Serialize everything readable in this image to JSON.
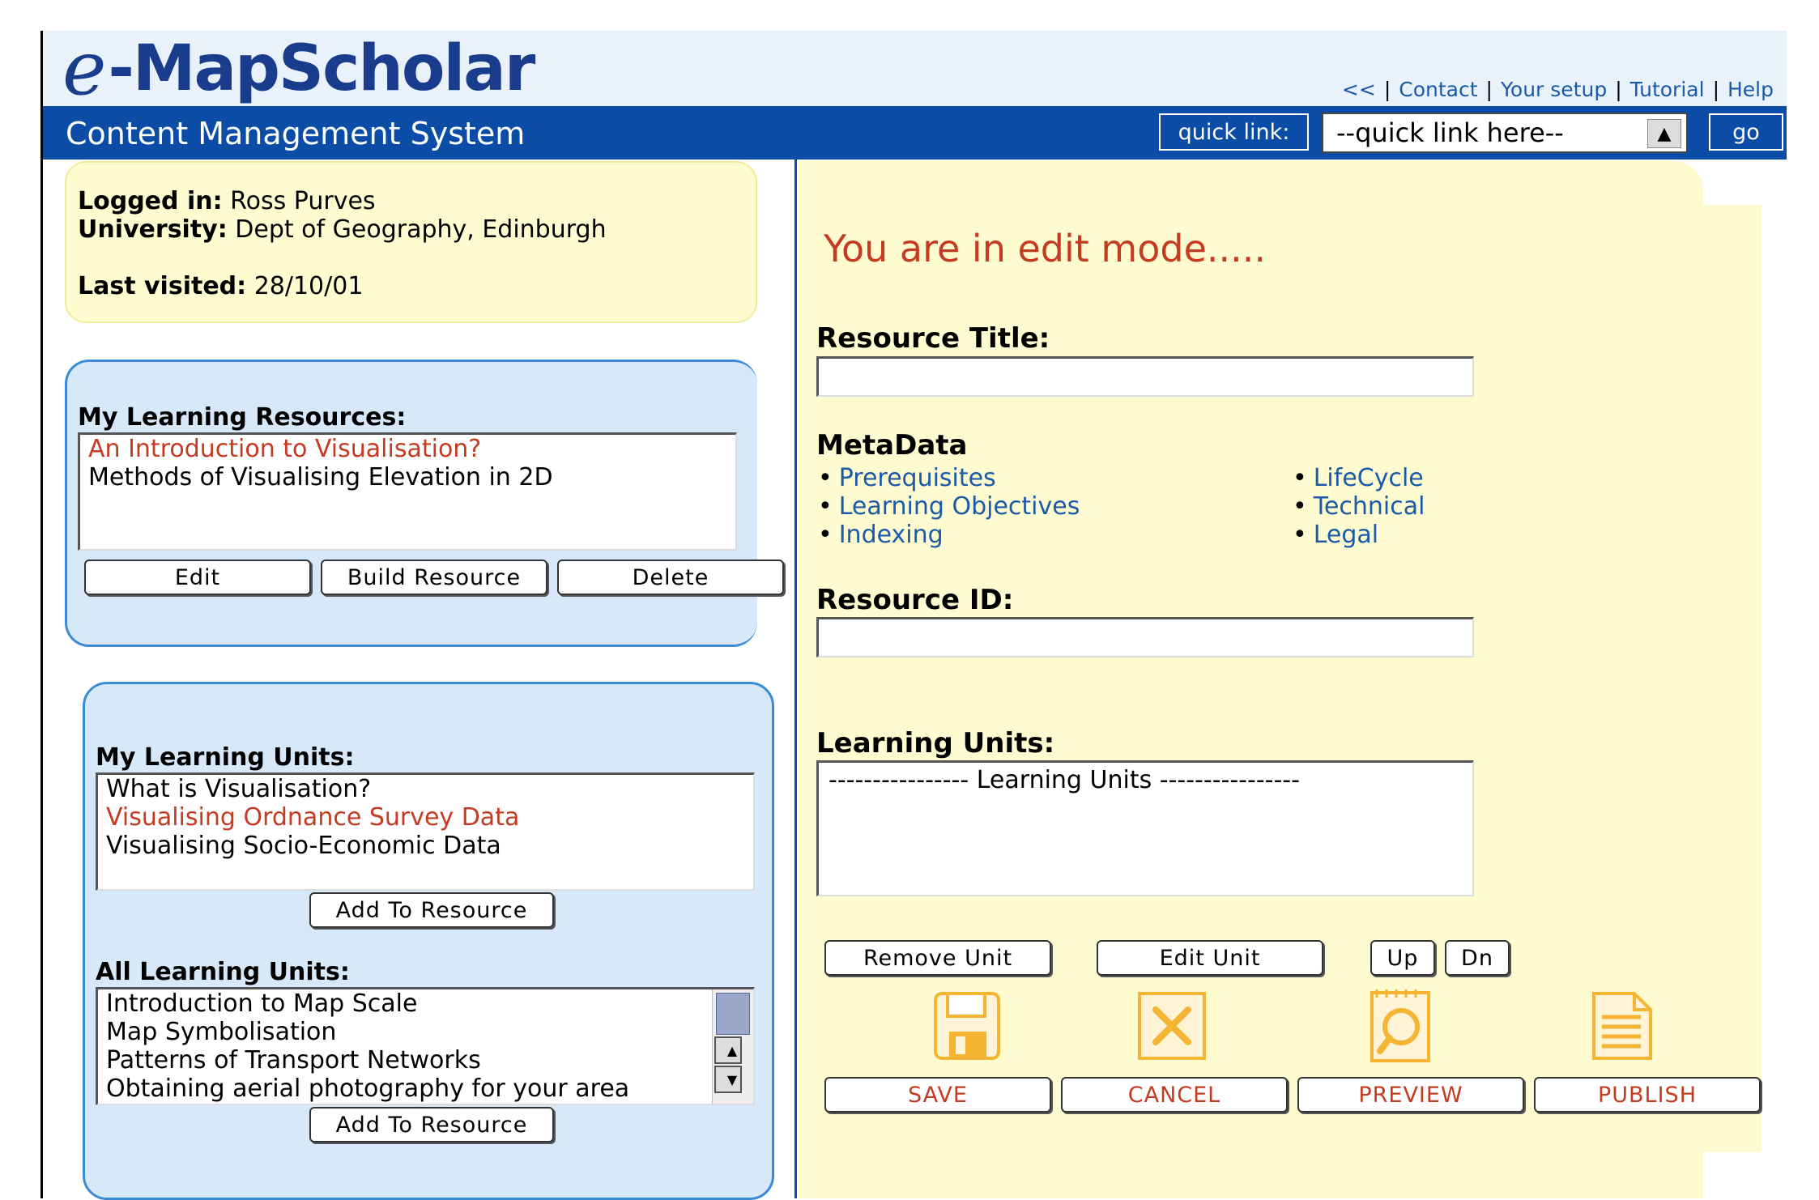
{
  "header": {
    "logo_e": "e",
    "logo_rest": "-MapScholar",
    "links": [
      "<<",
      "Contact",
      "Your setup",
      "Tutorial",
      "Help"
    ],
    "cms_title": "Content Management System",
    "quick_link_label": "quick link:",
    "quick_link_value": "--quick link here--",
    "go_label": "go"
  },
  "login": {
    "logged_in_label": "Logged in:",
    "logged_in_value": "Ross Purves",
    "university_label": "University:",
    "university_value": "Dept of Geography, Edinburgh",
    "last_visited_label": "Last visited:",
    "last_visited_value": "28/10/01"
  },
  "resources": {
    "heading": "My Learning Resources:",
    "items": [
      "An Introduction to Visualisation?",
      "Methods of Visualising Elevation in 2D"
    ],
    "edit_label": "Edit",
    "build_label": "Build Resource",
    "delete_label": "Delete"
  },
  "my_units": {
    "heading": "My Learning Units:",
    "items": [
      "What is Visualisation?",
      "Visualising Ordnance Survey Data",
      "Visualising Socio-Economic Data"
    ],
    "add_label": "Add To Resource"
  },
  "all_units": {
    "heading": "All Learning Units:",
    "items": [
      "Introduction to Map Scale",
      "Map Symbolisation",
      "Patterns of Transport Networks",
      "Obtaining aerial photography for your area"
    ],
    "add_label": "Add To Resource"
  },
  "edit": {
    "mode_text": "You are in edit mode.....",
    "resource_title_label": "Resource Title:",
    "resource_title_value": "",
    "metadata_label": "MetaData",
    "metadata_left": [
      "Prerequisites",
      "Learning Objectives",
      "Indexing"
    ],
    "metadata_right": [
      "LifeCycle",
      "Technical",
      "Legal"
    ],
    "resource_id_label": "Resource ID:",
    "resource_id_value": "",
    "learning_units_label": "Learning Units:",
    "learning_units_placeholder": "---------------- Learning Units ----------------",
    "remove_unit_label": "Remove Unit",
    "edit_unit_label": "Edit Unit",
    "up_label": "Up",
    "dn_label": "Dn",
    "save_label": "SAVE",
    "cancel_label": "CANCEL",
    "preview_label": "PREVIEW",
    "publish_label": "PUBLISH",
    "icons": [
      "floppy-disk-icon",
      "cancel-x-icon",
      "preview-magnifier-icon",
      "publish-document-icon"
    ]
  },
  "colors": {
    "brand_blue": "#0a4ca6",
    "panel_yellow": "#fefbd0",
    "panel_blue": "#d7e9f8",
    "accent_red": "#c43b22",
    "link_blue": "#1a5aa8",
    "icon_orange": "#f5b533"
  }
}
